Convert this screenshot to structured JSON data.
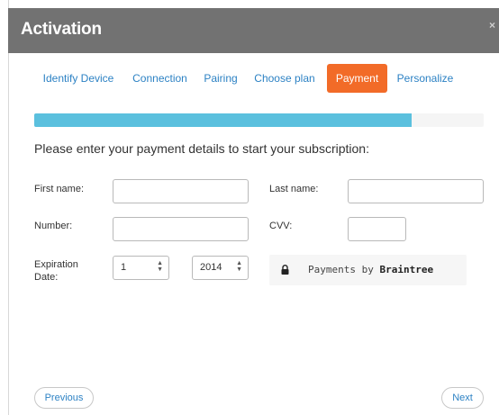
{
  "dialog": {
    "title": "Activation",
    "close_label": "×"
  },
  "tabs": [
    {
      "label": "Identify Device",
      "active": false
    },
    {
      "label": "Connection",
      "active": false
    },
    {
      "label": "Pairing",
      "active": false
    },
    {
      "label": "Choose plan",
      "active": false
    },
    {
      "label": "Payment",
      "active": true
    },
    {
      "label": "Personalize",
      "active": false
    }
  ],
  "progress": {
    "percent": 84
  },
  "instructions": "Please enter your payment details to start your subscription:",
  "form": {
    "first_name_label": "First name:",
    "first_name_value": "",
    "last_name_label": "Last name:",
    "last_name_value": "",
    "number_label": "Number:",
    "number_value": "",
    "cvv_label": "CVV:",
    "cvv_value": "",
    "expiration_label_line1": "Expiration",
    "expiration_label_line2": "Date:",
    "month_value": "1",
    "year_value": "2014"
  },
  "braintree": {
    "prefix": "Payments by ",
    "brand": "Braintree",
    "icon": "lock-icon"
  },
  "footer": {
    "previous_label": "Previous",
    "next_label": "Next"
  },
  "colors": {
    "titlebar": "#727272",
    "tab_link": "#2d82c4",
    "tab_active": "#f26b28",
    "progress_fill": "#5bc0de"
  }
}
